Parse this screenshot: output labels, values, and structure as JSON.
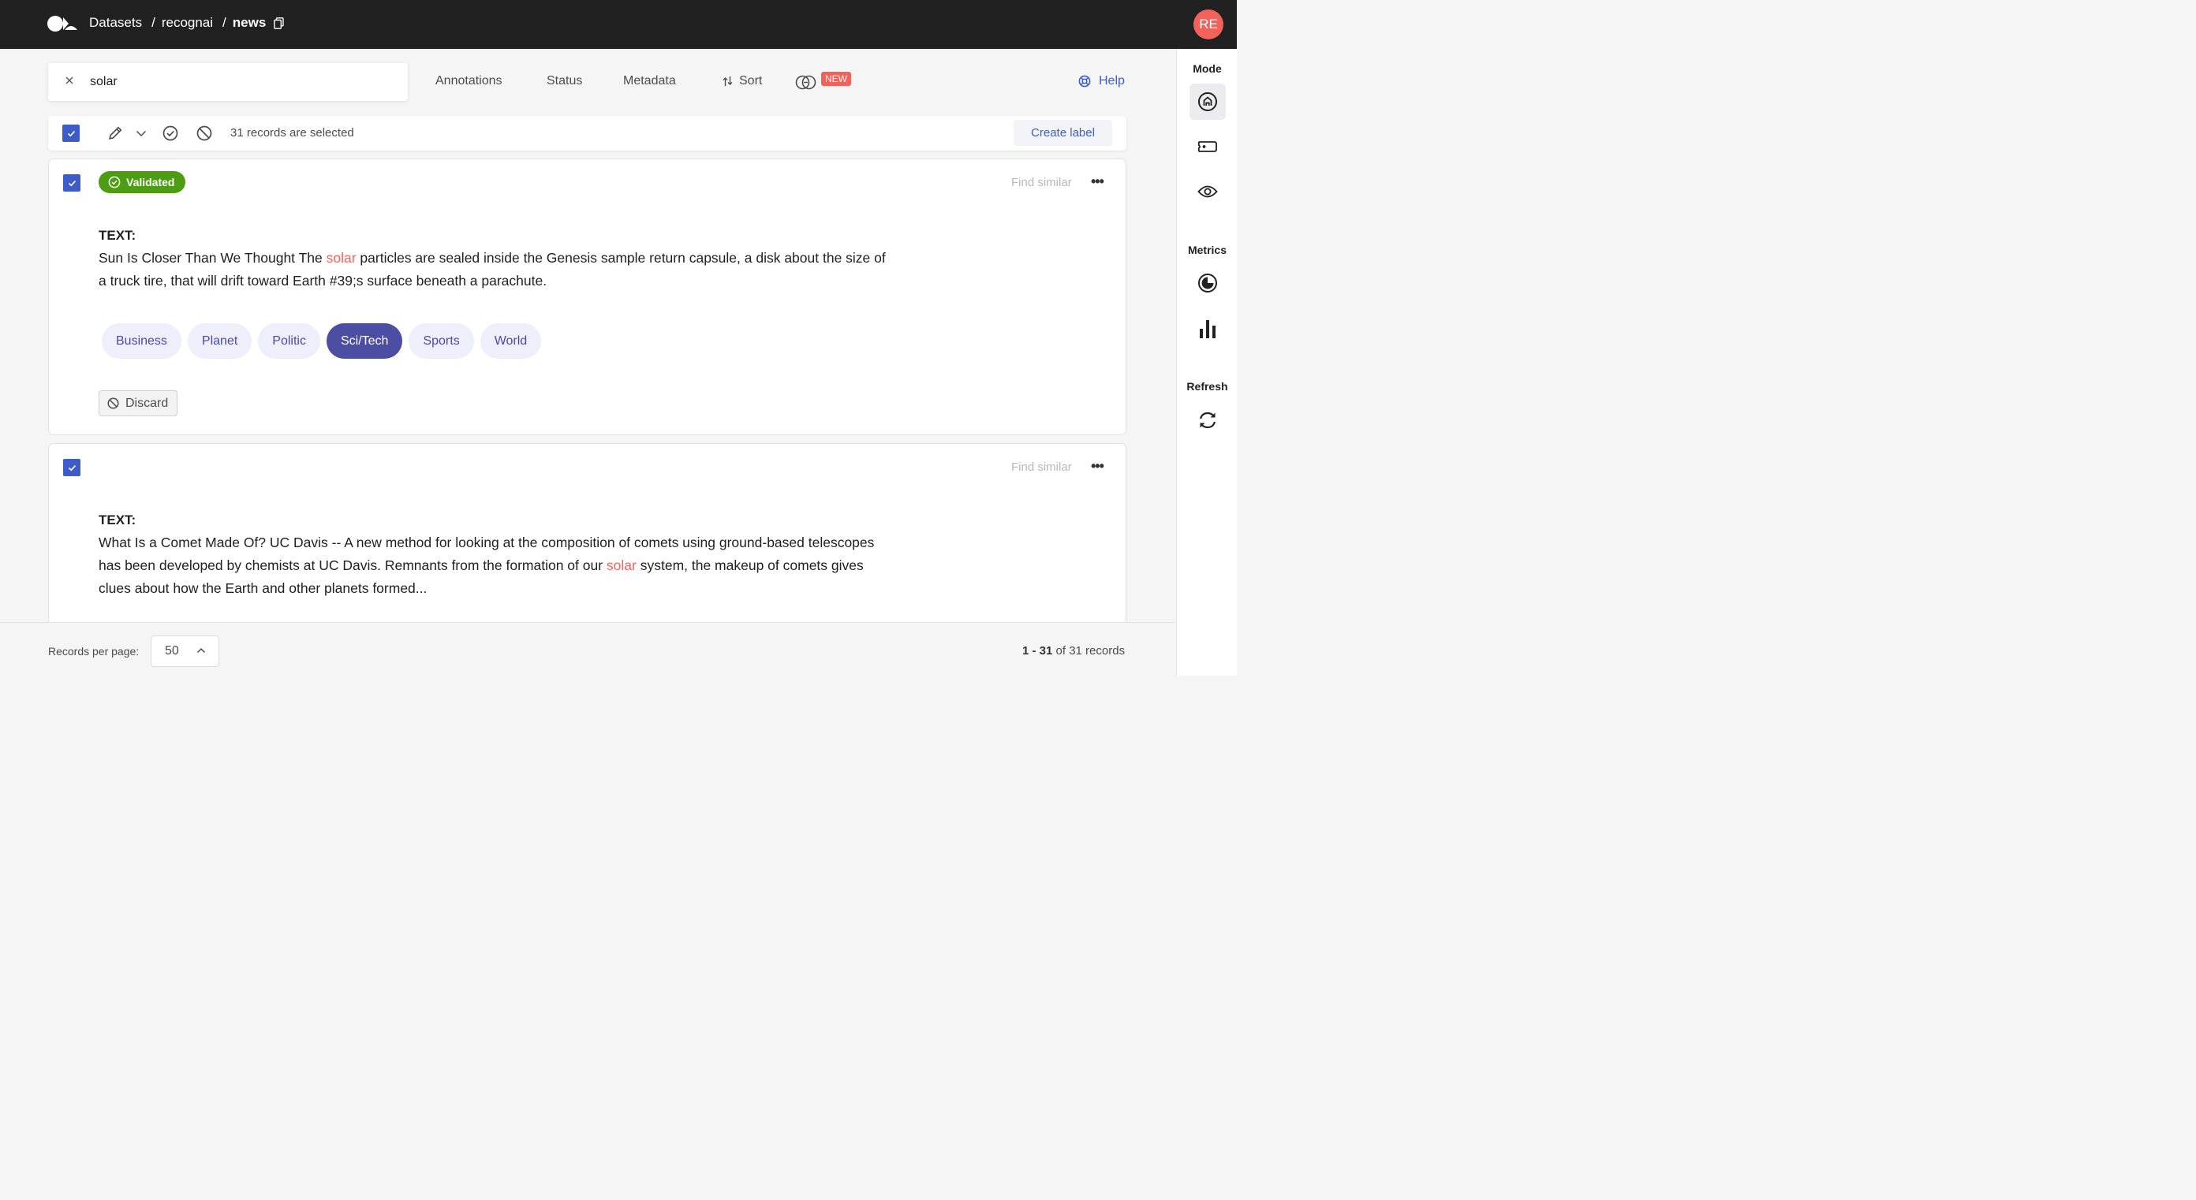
{
  "breadcrumb": {
    "item1": "Datasets",
    "sep1": "/",
    "item2": "recognai",
    "sep2": "/",
    "current": "news"
  },
  "user": {
    "initials": "RE"
  },
  "search": {
    "value": "solar"
  },
  "filters": {
    "annotations": "Annotations",
    "status": "Status",
    "metadata": "Metadata",
    "sort": "Sort",
    "new_badge": "NEW"
  },
  "help": {
    "label": "Help"
  },
  "bulk": {
    "selected_text": "31 records are selected",
    "create_label": "Create label"
  },
  "records": [
    {
      "status": "Validated",
      "find_similar": "Find similar",
      "more": "•••",
      "text_label": "TEXT:",
      "text_before": "Sun Is Closer Than We Thought The ",
      "text_highlight": "solar",
      "text_after": " particles are sealed inside the Genesis sample return capsule, a disk about the size of a truck tire, that will drift toward Earth #39;s surface beneath a parachute.",
      "labels": [
        "Business",
        "Planet",
        "Politic",
        "Sci/Tech",
        "Sports",
        "World"
      ],
      "selected_label": "Sci/Tech",
      "discard": "Discard"
    },
    {
      "find_similar": "Find similar",
      "more": "•••",
      "text_label": "TEXT:",
      "text_before": "What Is a Comet Made Of? UC Davis -- A new method for looking at the composition of comets using ground-based telescopes has been developed by chemists at UC Davis. Remnants from the formation of our ",
      "text_highlight": "solar",
      "text_after": " system, the makeup of comets gives clues about how the Earth and other planets formed..."
    }
  ],
  "sidebar": {
    "mode": "Mode",
    "metrics": "Metrics",
    "refresh": "Refresh"
  },
  "footer": {
    "rpp_label": "Records per page:",
    "rpp_value": "50",
    "range": "1 - 31",
    "of_text": " of 31 records"
  },
  "colors": {
    "accent": "#3e5cc9",
    "highlight": "#f2625b",
    "validated": "#4c9d12",
    "chip_selected": "#4c4ea3"
  },
  "icons": [
    "logo-icon",
    "copy-icon",
    "close-icon",
    "gear-icon",
    "sort-icon",
    "help-icon",
    "pencil-icon",
    "chevron-down-icon",
    "check-circle-icon",
    "ban-icon",
    "more-icon",
    "explore-mode-icon",
    "label-mode-icon",
    "review-mode-icon",
    "progress-icon",
    "bar-chart-icon",
    "refresh-icon",
    "chevron-up-icon"
  ]
}
